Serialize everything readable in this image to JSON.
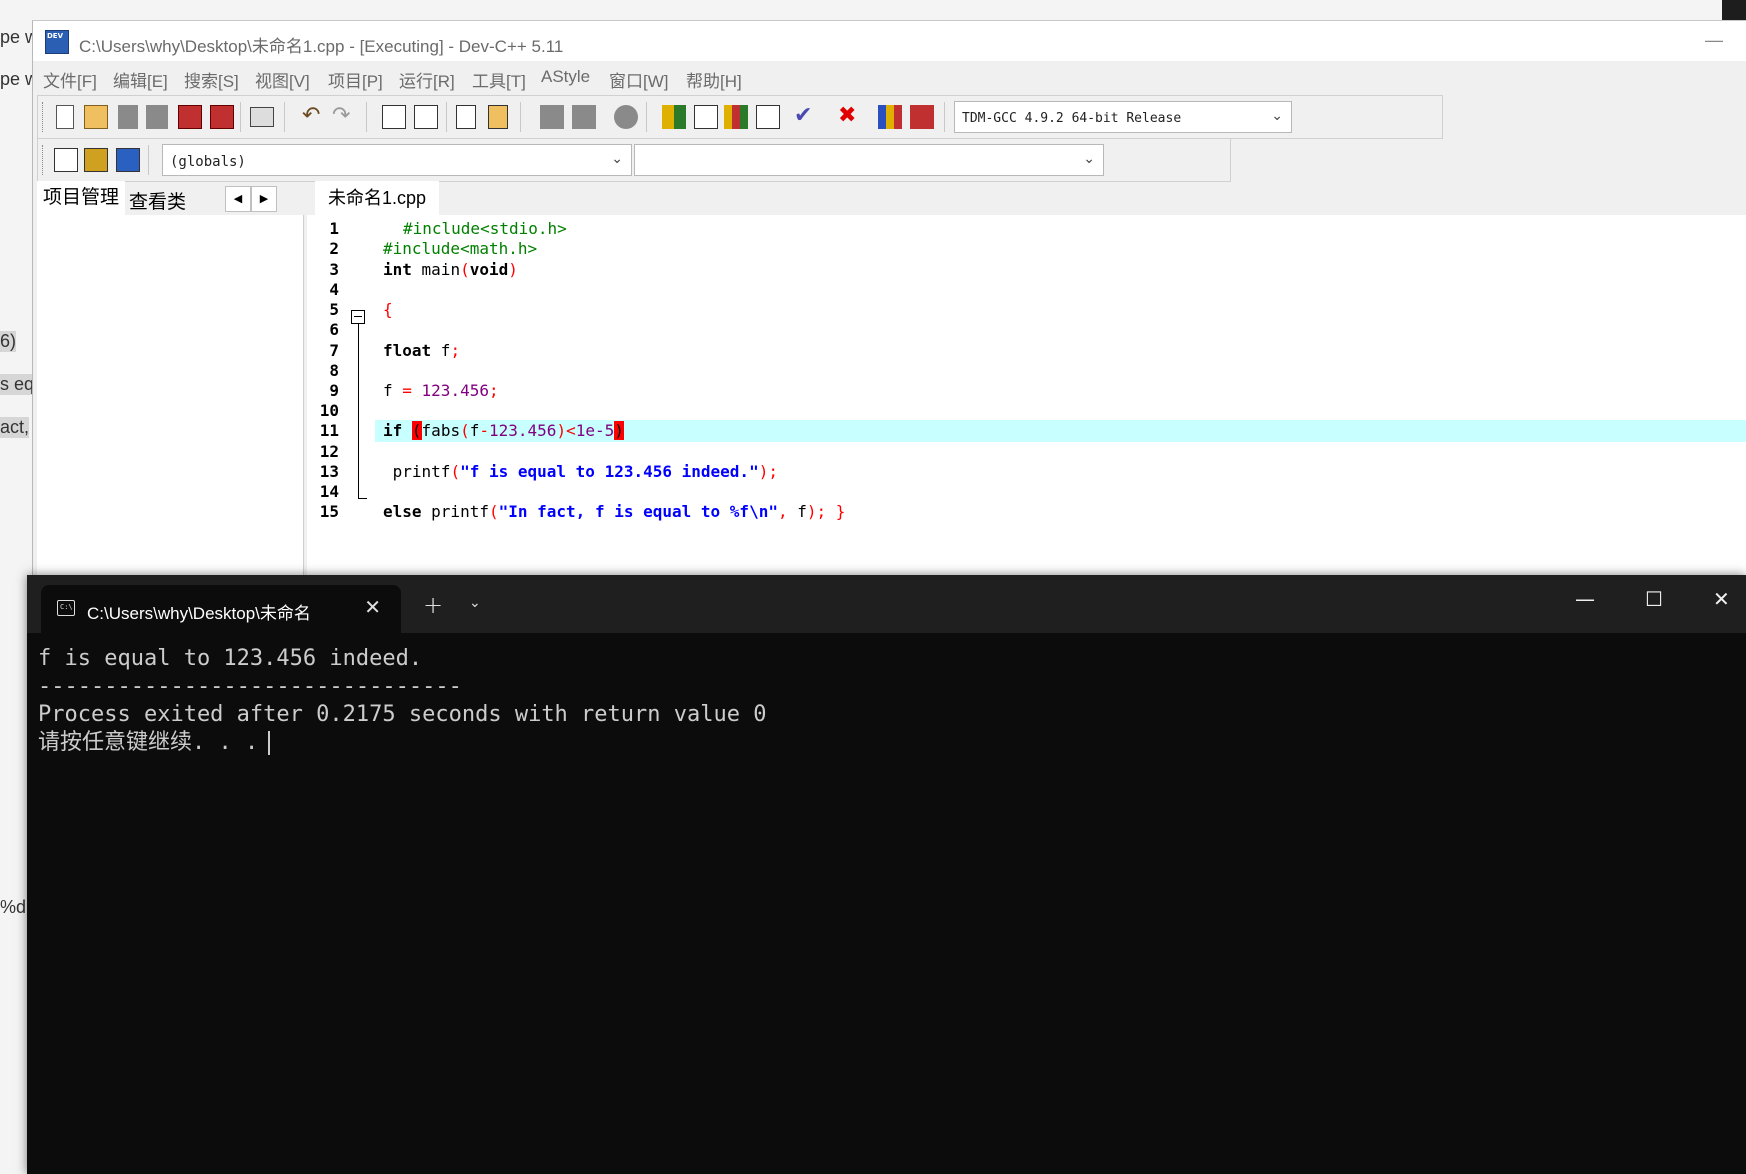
{
  "background": {
    "fragments": [
      "pe w",
      "pe w",
      "6)",
      "s eq",
      "act,",
      "%d,"
    ]
  },
  "devcpp": {
    "title": "C:\\Users\\why\\Desktop\\未命名1.cpp - [Executing] - Dev-C++ 5.11",
    "minimize": "—",
    "menu": [
      "文件[F]",
      "编辑[E]",
      "搜索[S]",
      "视图[V]",
      "项目[P]",
      "运行[R]",
      "工具[T]",
      "AStyle",
      "窗口[W]",
      "帮助[H]"
    ],
    "compiler": "TDM-GCC 4.9.2 64-bit Release",
    "scope": "(globals)",
    "symbol": "",
    "left_tabs": [
      "项目管理",
      "查看类"
    ],
    "file_tab": "未命名1.cpp",
    "line_numbers": [
      "1",
      "2",
      "3",
      "4",
      "5",
      "6",
      "7",
      "8",
      "9",
      "10",
      "11",
      "12",
      "13",
      "14",
      "15"
    ],
    "code": {
      "l1": "#include<stdio.h>",
      "l2": "#include<math.h>",
      "l3_kw": "int",
      "l3_rest": " main",
      "l3_p1": "(",
      "l3_void": "void",
      "l3_p2": ")",
      "l5": "{",
      "l7_kw": "float",
      "l7_rest": " f",
      "l7_semi": ";",
      "l9_a": "f ",
      "l9_eq": "=",
      "l9_num": " 123.456",
      "l9_semi": ";",
      "l11_kw": "if ",
      "l11_open": "(",
      "l11_fn": "fabs",
      "l11_p": "(",
      "l11_f": "f",
      "l11_minus": "-",
      "l11_num": "123.456",
      "l11_pc": ")",
      "l11_lt": "<",
      "l11_num2": "1e-5",
      "l11_close": ")",
      "l13_fn": " printf",
      "l13_p": "(",
      "l13_str": "\"f is equal to 123.456 indeed.\"",
      "l13_end": ");",
      "l15_kw": "else",
      "l15_fn": " printf",
      "l15_p": "(",
      "l15_str": "\"In fact, f is equal to %f\\n\"",
      "l15_comma": ",",
      "l15_f": " f",
      "l15_end": ");",
      "l15_brace": " }"
    }
  },
  "terminal": {
    "tab_title": "C:\\Users\\why\\Desktop\\未命名",
    "close": "✕",
    "new_tab": "+",
    "dropdown": "⌄",
    "minimize": "—",
    "maximize": "☐",
    "close_window": "✕",
    "lines": [
      "f is equal to 123.456 indeed.",
      "--------------------------------",
      "Process exited after 0.2175 seconds with return value 0",
      "请按任意键继续. . ."
    ]
  }
}
